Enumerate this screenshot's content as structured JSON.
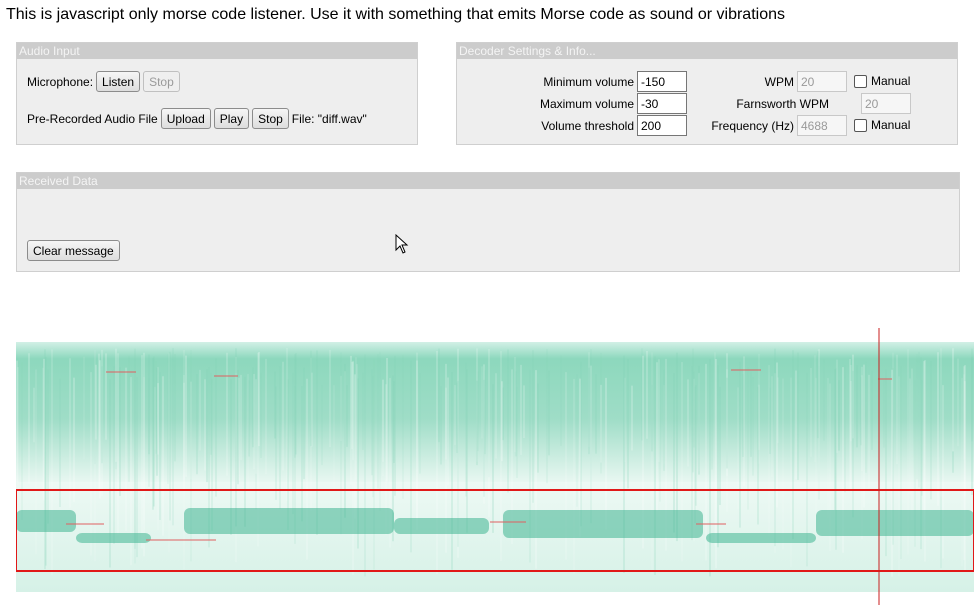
{
  "intro_text": "This is javascript only morse code listener. Use it with something that emits Morse code as sound or vibrations",
  "audio_input": {
    "title": "Audio Input",
    "microphone_label": "Microphone:",
    "listen_label": "Listen",
    "stop_label": "Stop",
    "prerecorded_label": "Pre-Recorded Audio File",
    "upload_label": "Upload",
    "play_label": "Play",
    "file_stop_label": "Stop",
    "file_text": "File: \"diff.wav\""
  },
  "decoder": {
    "title": "Decoder Settings & Info...",
    "min_volume_label": "Minimum volume",
    "min_volume_value": "-150",
    "max_volume_label": "Maximum volume",
    "max_volume_value": "-30",
    "threshold_label": "Volume threshold",
    "threshold_value": "200",
    "wpm_label": "WPM",
    "wpm_value": "20",
    "wpm_manual_label": "Manual",
    "farnsworth_label": "Farnsworth WPM",
    "farnsworth_value": "20",
    "frequency_label": "Frequency (Hz)",
    "frequency_value": "4688",
    "frequency_manual_label": "Manual"
  },
  "received": {
    "title": "Received Data",
    "clear_label": "Clear message"
  },
  "spectrogram": {
    "noise_color": "#5cc7a5",
    "signal_color": "#3fb592",
    "highlight_color": "#e01818",
    "cursor_color": "#c81e1e"
  }
}
